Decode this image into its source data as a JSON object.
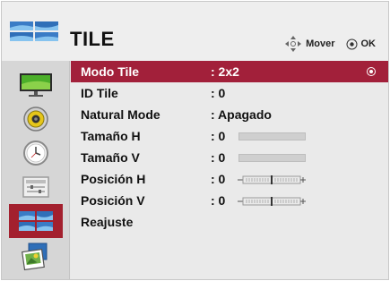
{
  "header": {
    "title": "TILE",
    "hints": [
      {
        "icon": "four-way-arrow-icon",
        "label": "Mover"
      },
      {
        "icon": "ok-circle-icon",
        "label": "OK"
      }
    ]
  },
  "sidebar": {
    "items": [
      {
        "icon": "picture-monitor-icon",
        "active": false
      },
      {
        "icon": "speaker-icon",
        "active": false
      },
      {
        "icon": "clock-icon",
        "active": false
      },
      {
        "icon": "options-icon",
        "active": false
      },
      {
        "icon": "tile-icon",
        "active": true
      },
      {
        "icon": "photo-gallery-icon",
        "active": false
      }
    ]
  },
  "menu": {
    "rows": [
      {
        "label": "Modo Tile",
        "value": ": 2x2",
        "selected": true,
        "control": "radio"
      },
      {
        "label": "ID Tile",
        "value": ": 0",
        "control": "none"
      },
      {
        "label": "Natural Mode",
        "value": ": Apagado",
        "control": "none"
      },
      {
        "label": "Tamaño H",
        "value": ": 0",
        "control": "bar",
        "level": 0
      },
      {
        "label": "Tamaño V",
        "value": ": 0",
        "control": "bar",
        "level": 0
      },
      {
        "label": "Posición H",
        "value": ": 0",
        "control": "slider",
        "position": 0.5
      },
      {
        "label": "Posición V",
        "value": ": 0",
        "control": "slider",
        "position": 0.5
      },
      {
        "label": "Reajuste",
        "value": "",
        "control": "none"
      }
    ]
  },
  "colors": {
    "accent": "#a2203a",
    "background": "#eaeaea",
    "sidebar": "#d6d6d6"
  }
}
